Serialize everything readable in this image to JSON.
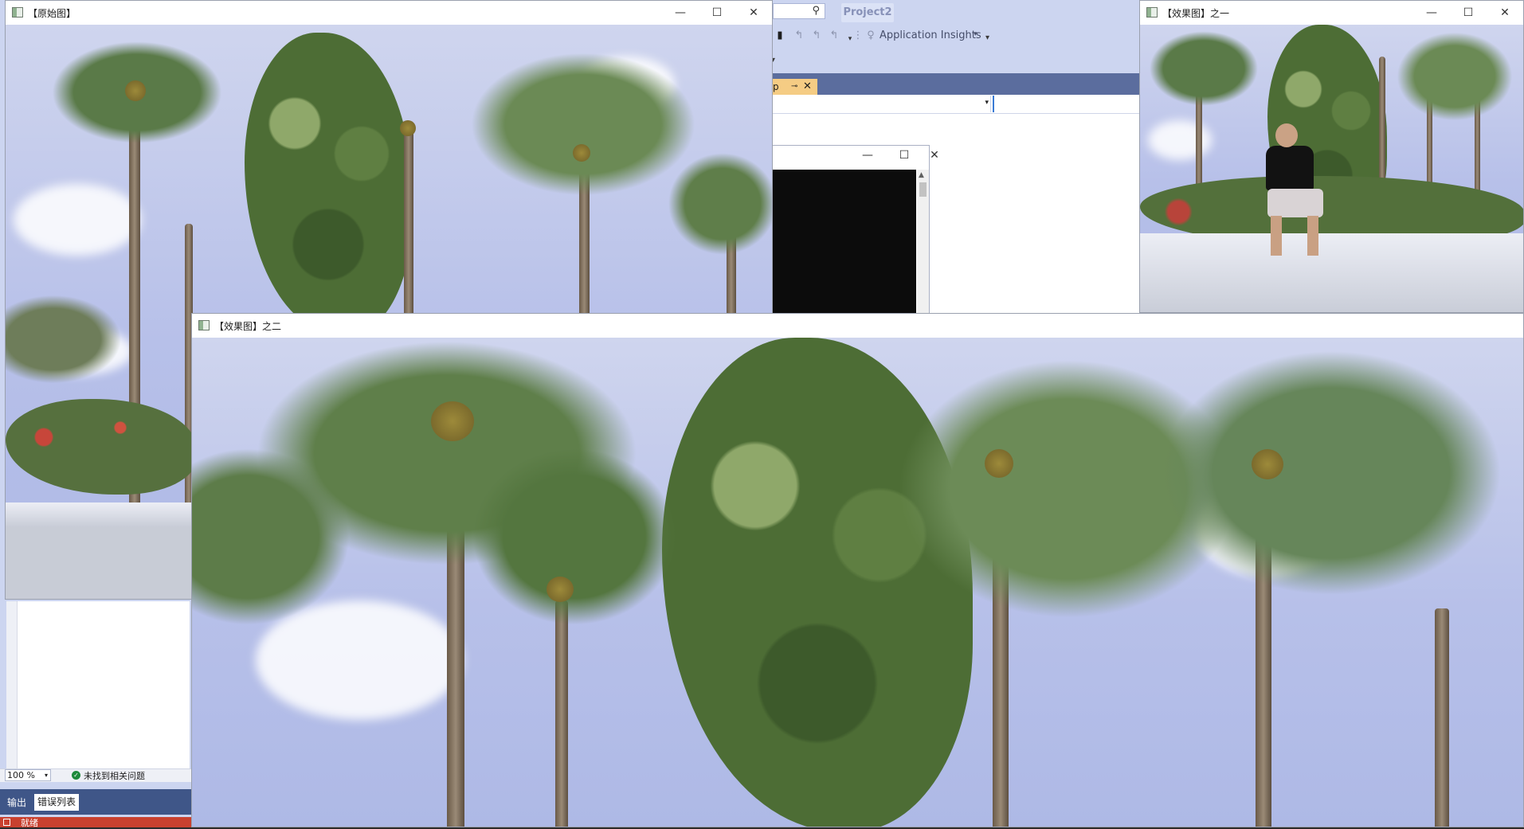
{
  "vs": {
    "project_name": "Project2",
    "search_glyph": "🔍",
    "application_insights": "Application Insights",
    "editor_tab": "p",
    "zoom": "100 %",
    "no_issues": "未找到相关问题",
    "panel_tabs": [
      "输出",
      "错误列表"
    ],
    "status": "就绪"
  },
  "windows": {
    "original": {
      "title": "【原始图】"
    },
    "effect1": {
      "title": "【效果图】之一"
    },
    "effect2": {
      "title": "【效果图】之二"
    }
  },
  "caption_buttons": {
    "minimize": "—",
    "maximize": "☐",
    "close": "✕"
  }
}
